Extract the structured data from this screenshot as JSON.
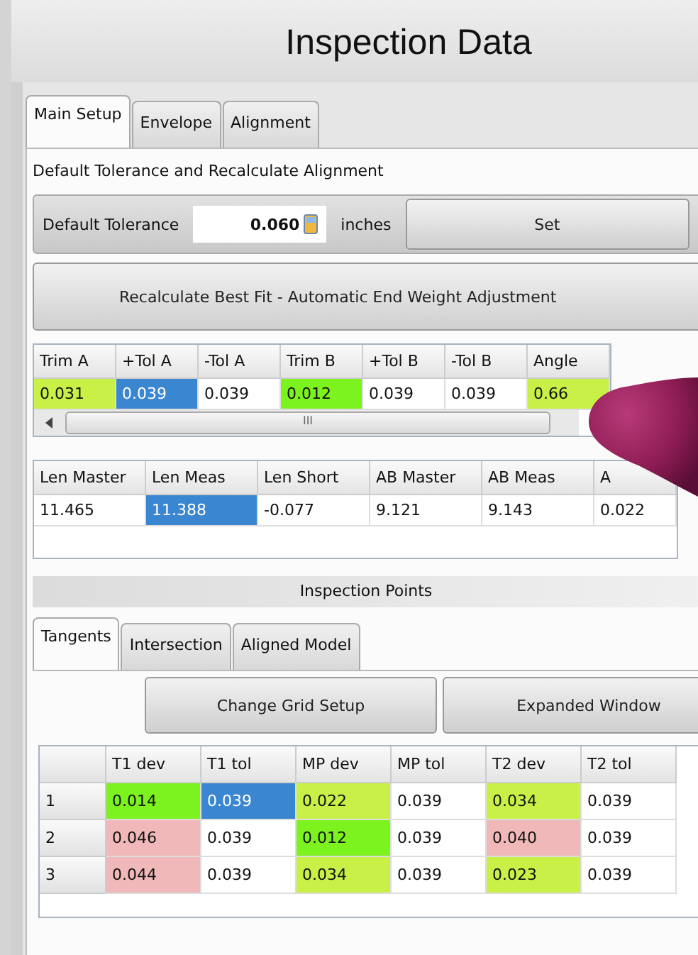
{
  "window": {
    "title": "Inspection Data"
  },
  "tabs": [
    {
      "label": "Main Setup",
      "selected": true
    },
    {
      "label": "Envelope",
      "selected": false
    },
    {
      "label": "Alignment",
      "selected": false
    }
  ],
  "section_label": "Default Tolerance and Recalculate Alignment",
  "tolerance": {
    "label": "Default Tolerance",
    "value": "0.060",
    "unit": "inches",
    "button": "Set"
  },
  "recalculate_button": "Recalculate Best Fit - Automatic End Weight Adjustment",
  "trim_table": {
    "columns": [
      "Trim A",
      "+Tol A",
      "-Tol A",
      "Trim B",
      "+Tol B",
      "-Tol B",
      "Angle"
    ],
    "row": [
      {
        "text": "0.031",
        "color": "#c8f046",
        "selected": false
      },
      {
        "text": "0.039",
        "color": "#3a86d0",
        "selected": true
      },
      {
        "text": "0.039",
        "color": "#ffffff",
        "selected": false
      },
      {
        "text": "0.012",
        "color": "#7cf21e",
        "selected": false
      },
      {
        "text": "0.039",
        "color": "#ffffff",
        "selected": false
      },
      {
        "text": "0.039",
        "color": "#ffffff",
        "selected": false
      },
      {
        "text": "0.66",
        "color": "#c8f046",
        "selected": false
      }
    ],
    "scroll_grip": "III"
  },
  "length_table": {
    "columns": [
      "Len Master",
      "Len Meas",
      "Len Short",
      "AB Master",
      "AB Meas",
      "A"
    ],
    "row": [
      {
        "text": "11.465",
        "color": "#ffffff",
        "selected": false
      },
      {
        "text": "11.388",
        "color": "#3a86d0",
        "selected": true
      },
      {
        "text": "-0.077",
        "color": "#ffffff",
        "selected": false
      },
      {
        "text": "9.121",
        "color": "#ffffff",
        "selected": false
      },
      {
        "text": "9.143",
        "color": "#ffffff",
        "selected": false
      },
      {
        "text": "0.022",
        "color": "#ffffff",
        "selected": false
      }
    ]
  },
  "inspection_points": {
    "title": "Inspection Points",
    "tabs": [
      {
        "label": "Tangents",
        "selected": true
      },
      {
        "label": "Intersection",
        "selected": false
      },
      {
        "label": "Aligned Model",
        "selected": false
      }
    ],
    "buttons": [
      "Change Grid Setup",
      "Expanded Window"
    ],
    "columns": [
      "T1 dev",
      "T1 tol",
      "MP dev",
      "MP tol",
      "T2 dev",
      "T2 tol"
    ],
    "rows": [
      {
        "label": "1",
        "cells": [
          {
            "text": "0.014",
            "color": "#7cf21e",
            "selected": false
          },
          {
            "text": "0.039",
            "color": "#3a86d0",
            "selected": true
          },
          {
            "text": "0.022",
            "color": "#c8f046",
            "selected": false
          },
          {
            "text": "0.039",
            "color": "#ffffff",
            "selected": false
          },
          {
            "text": "0.034",
            "color": "#c8f046",
            "selected": false
          },
          {
            "text": "0.039",
            "color": "#ffffff",
            "selected": false
          }
        ]
      },
      {
        "label": "2",
        "cells": [
          {
            "text": "0.046",
            "color": "#f0b8b8",
            "selected": false
          },
          {
            "text": "0.039",
            "color": "#ffffff",
            "selected": false
          },
          {
            "text": "0.012",
            "color": "#7cf21e",
            "selected": false
          },
          {
            "text": "0.039",
            "color": "#ffffff",
            "selected": false
          },
          {
            "text": "0.040",
            "color": "#f0b8b8",
            "selected": false
          },
          {
            "text": "0.039",
            "color": "#ffffff",
            "selected": false
          }
        ]
      },
      {
        "label": "3",
        "cells": [
          {
            "text": "0.044",
            "color": "#f0b8b8",
            "selected": false
          },
          {
            "text": "0.039",
            "color": "#ffffff",
            "selected": false
          },
          {
            "text": "0.034",
            "color": "#c8f046",
            "selected": false
          },
          {
            "text": "0.039",
            "color": "#ffffff",
            "selected": false
          },
          {
            "text": "0.023",
            "color": "#c8f046",
            "selected": false
          },
          {
            "text": "0.039",
            "color": "#ffffff",
            "selected": false
          }
        ]
      }
    ]
  }
}
